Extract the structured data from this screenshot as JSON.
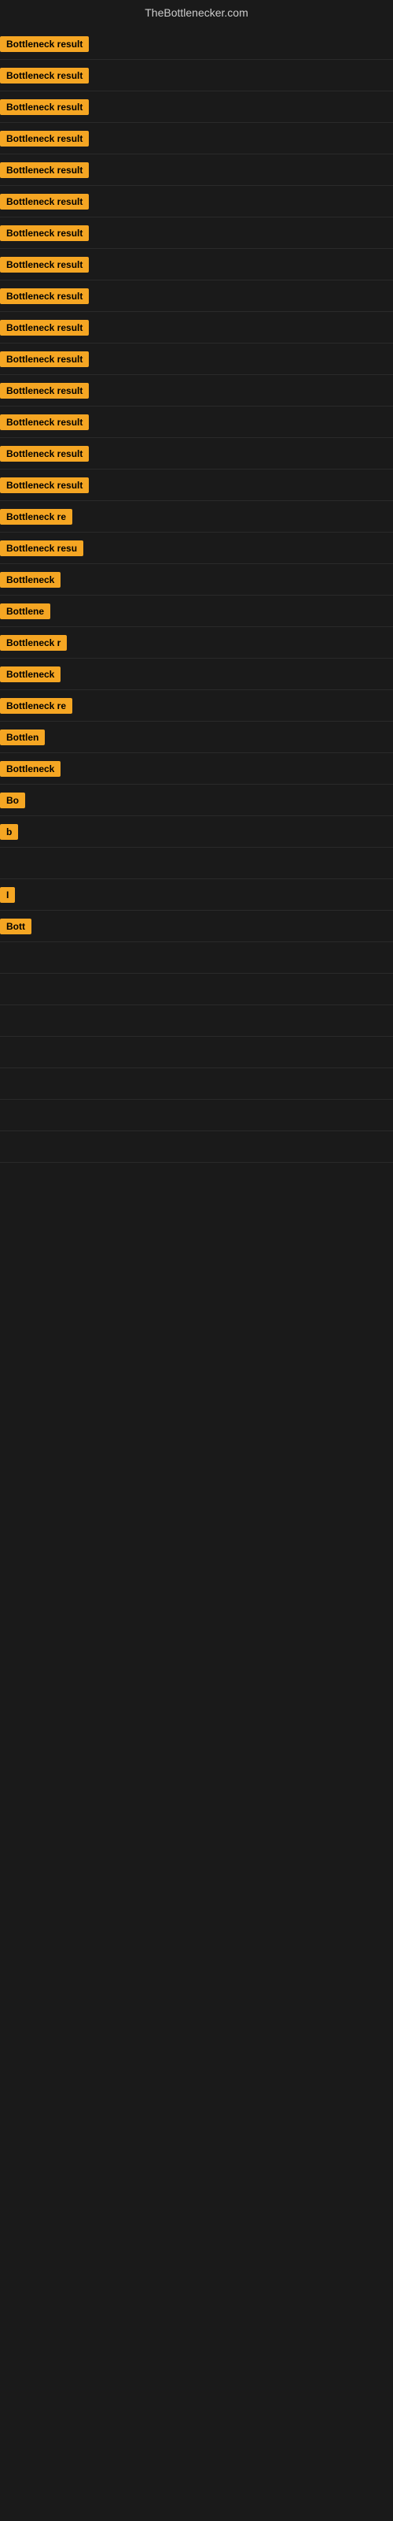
{
  "header": {
    "title": "TheBottlenecker.com"
  },
  "labels": {
    "bottleneck_result": "Bottleneck result"
  },
  "rows": [
    {
      "id": 1,
      "label": "Bottleneck result",
      "width": 120,
      "visible_text": "Bottleneck result"
    },
    {
      "id": 2,
      "label": "Bottleneck result",
      "width": 120,
      "visible_text": "Bottleneck result"
    },
    {
      "id": 3,
      "label": "Bottleneck result",
      "width": 120,
      "visible_text": "Bottleneck result"
    },
    {
      "id": 4,
      "label": "Bottleneck result",
      "width": 120,
      "visible_text": "Bottleneck result"
    },
    {
      "id": 5,
      "label": "Bottleneck result",
      "width": 120,
      "visible_text": "Bottleneck result"
    },
    {
      "id": 6,
      "label": "Bottleneck result",
      "width": 120,
      "visible_text": "Bottleneck result"
    },
    {
      "id": 7,
      "label": "Bottleneck result",
      "width": 120,
      "visible_text": "Bottleneck result"
    },
    {
      "id": 8,
      "label": "Bottleneck result",
      "width": 120,
      "visible_text": "Bottleneck result"
    },
    {
      "id": 9,
      "label": "Bottleneck result",
      "width": 120,
      "visible_text": "Bottleneck result"
    },
    {
      "id": 10,
      "label": "Bottleneck result",
      "width": 118,
      "visible_text": "Bottleneck result"
    },
    {
      "id": 11,
      "label": "Bottleneck result",
      "width": 115,
      "visible_text": "Bottleneck result"
    },
    {
      "id": 12,
      "label": "Bottleneck result",
      "width": 112,
      "visible_text": "Bottleneck result"
    },
    {
      "id": 13,
      "label": "Bottleneck result",
      "width": 110,
      "visible_text": "Bottleneck result"
    },
    {
      "id": 14,
      "label": "Bottleneck result",
      "width": 108,
      "visible_text": "Bottleneck result"
    },
    {
      "id": 15,
      "label": "Bottleneck result",
      "width": 105,
      "visible_text": "Bottleneck result"
    },
    {
      "id": 16,
      "label": "Bottleneck re",
      "width": 95,
      "visible_text": "Bottleneck re"
    },
    {
      "id": 17,
      "label": "Bottleneck resu",
      "width": 100,
      "visible_text": "Bottleneck resu"
    },
    {
      "id": 18,
      "label": "Bottleneck",
      "width": 80,
      "visible_text": "Bottleneck"
    },
    {
      "id": 19,
      "label": "Bottlene",
      "width": 70,
      "visible_text": "Bottlene"
    },
    {
      "id": 20,
      "label": "Bottleneck r",
      "width": 88,
      "visible_text": "Bottleneck r"
    },
    {
      "id": 21,
      "label": "Bottleneck",
      "width": 75,
      "visible_text": "Bottleneck"
    },
    {
      "id": 22,
      "label": "Bottleneck re",
      "width": 90,
      "visible_text": "Bottleneck re"
    },
    {
      "id": 23,
      "label": "Bottlen",
      "width": 62,
      "visible_text": "Bottlen"
    },
    {
      "id": 24,
      "label": "Bottleneck",
      "width": 72,
      "visible_text": "Bottleneck"
    },
    {
      "id": 25,
      "label": "Bo",
      "width": 30,
      "visible_text": "Bo"
    },
    {
      "id": 26,
      "label": "b",
      "width": 14,
      "visible_text": "b"
    },
    {
      "id": 27,
      "label": "",
      "width": 0,
      "visible_text": ""
    },
    {
      "id": 28,
      "label": "I",
      "width": 10,
      "visible_text": "I"
    },
    {
      "id": 29,
      "label": "Bott",
      "width": 38,
      "visible_text": "Bott"
    },
    {
      "id": 30,
      "label": "",
      "width": 0,
      "visible_text": ""
    },
    {
      "id": 31,
      "label": "",
      "width": 0,
      "visible_text": ""
    },
    {
      "id": 32,
      "label": "",
      "width": 0,
      "visible_text": ""
    },
    {
      "id": 33,
      "label": "",
      "width": 0,
      "visible_text": ""
    },
    {
      "id": 34,
      "label": "",
      "width": 0,
      "visible_text": ""
    },
    {
      "id": 35,
      "label": "",
      "width": 0,
      "visible_text": ""
    },
    {
      "id": 36,
      "label": "",
      "width": 0,
      "visible_text": ""
    }
  ]
}
